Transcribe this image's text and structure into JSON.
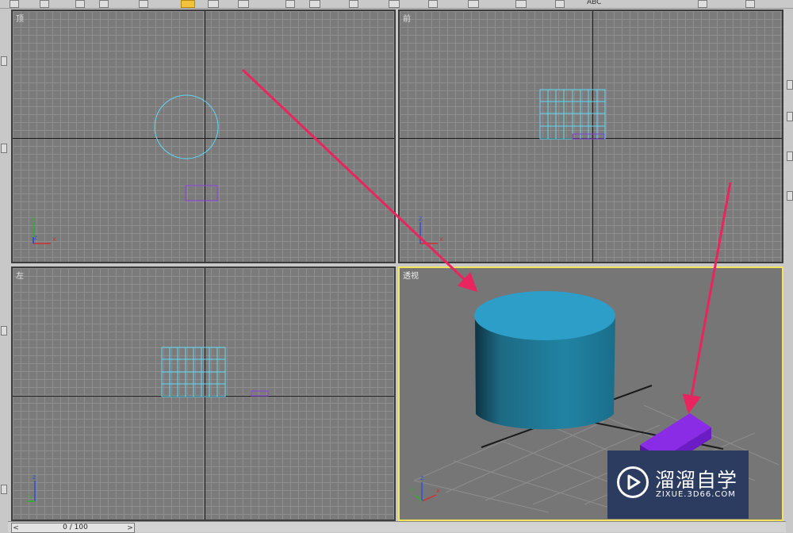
{
  "toolbar": {
    "abc_label": "ABC"
  },
  "viewports": {
    "top": {
      "label": "顶"
    },
    "front": {
      "label": "前"
    },
    "left": {
      "label": "左"
    },
    "perspective": {
      "label": "透视"
    }
  },
  "gizmo": {
    "x": "x",
    "y": "y",
    "z": "z"
  },
  "timeline": {
    "frame_text": "0 / 100",
    "prev": "<",
    "next": ">"
  },
  "watermark": {
    "name": "溜溜自学",
    "url": "ZIXUE.3D66.COM"
  },
  "colors": {
    "viewport_bg": "#7b7b7b",
    "grid_line": "#8f8f8f",
    "cylinder": "#2c9ec8",
    "cylinder_wire": "#5fd8f4",
    "box": "#7a1dd8",
    "annotation_arrow": "#e8255e",
    "active_border": "#f3e45a"
  }
}
